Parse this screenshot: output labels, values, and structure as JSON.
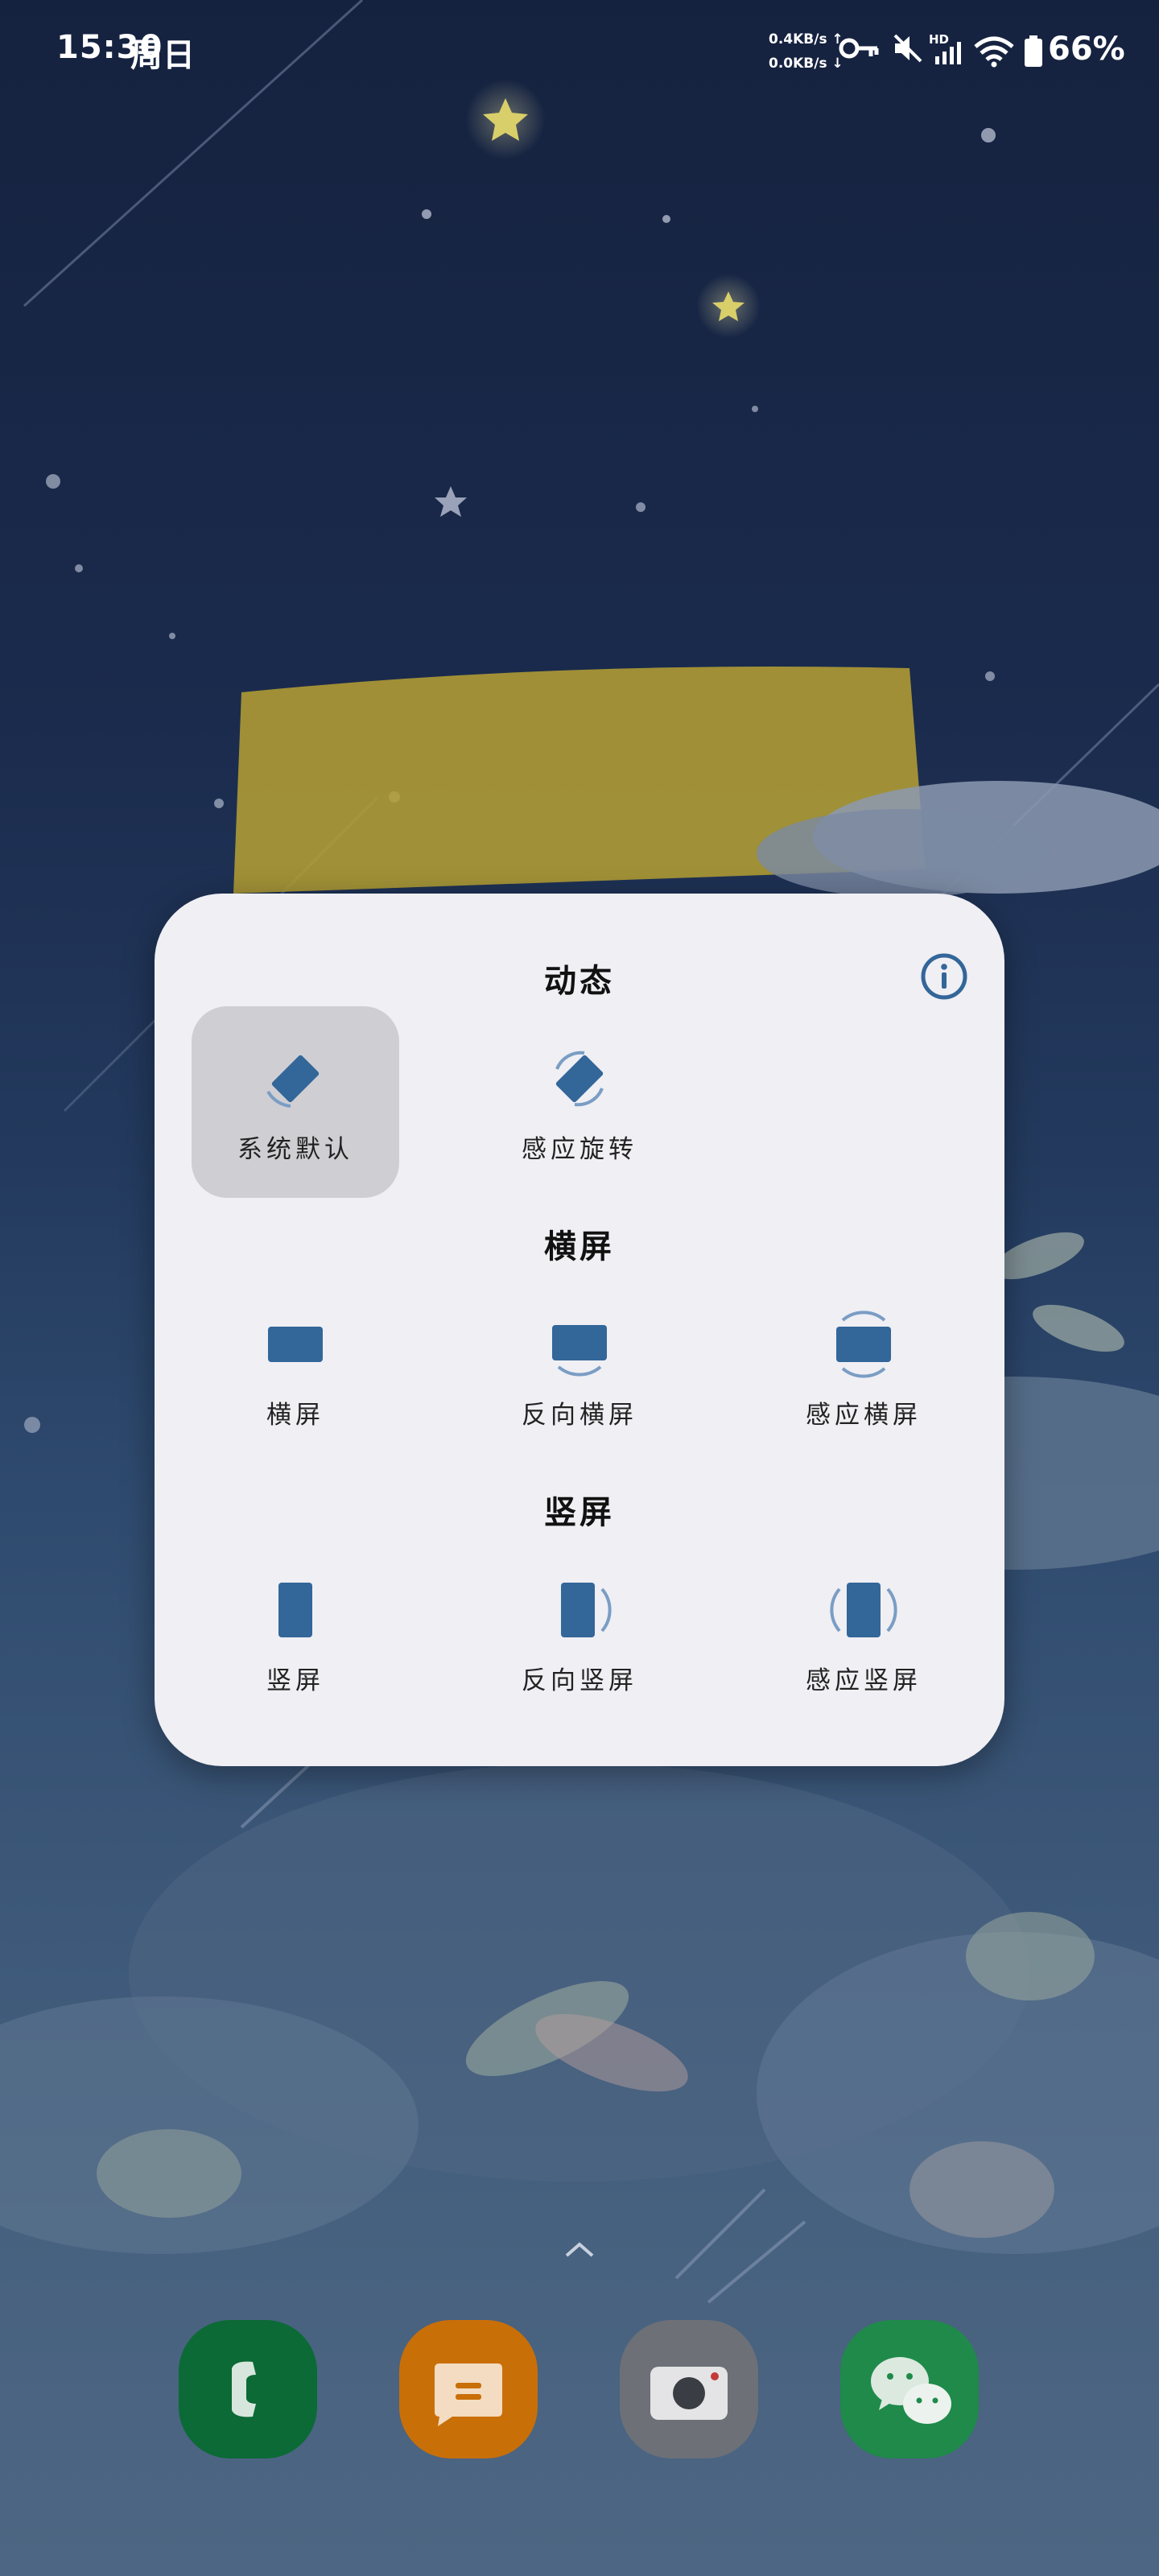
{
  "status_bar": {
    "time": "15:30",
    "day": "周日",
    "upload_speed": "0.4KB/s ↑",
    "download_speed": "0.0KB/s ↓",
    "network_type": "HD",
    "battery": "66%",
    "icons": [
      "key-icon",
      "mute-icon",
      "signal-icon",
      "wifi-icon",
      "battery-icon"
    ]
  },
  "rotation_panel": {
    "info_icon": "info-icon",
    "accent_color": "#336699",
    "sections": [
      {
        "title": "动态",
        "options": [
          {
            "label": "系统默认",
            "icon": "system-default-rotation-icon",
            "selected": true
          },
          {
            "label": "感应旋转",
            "icon": "sensor-rotation-icon",
            "selected": false
          }
        ]
      },
      {
        "title": "横屏",
        "options": [
          {
            "label": "横屏",
            "icon": "landscape-icon",
            "selected": false
          },
          {
            "label": "反向横屏",
            "icon": "reverse-landscape-icon",
            "selected": false
          },
          {
            "label": "感应横屏",
            "icon": "sensor-landscape-icon",
            "selected": false
          }
        ]
      },
      {
        "title": "竖屏",
        "options": [
          {
            "label": "竖屏",
            "icon": "portrait-icon",
            "selected": false
          },
          {
            "label": "反向竖屏",
            "icon": "reverse-portrait-icon",
            "selected": false
          },
          {
            "label": "感应竖屏",
            "icon": "sensor-portrait-icon",
            "selected": false
          }
        ]
      }
    ]
  },
  "home": {
    "swipe_up_icon": "chevron-up-icon",
    "dock": [
      {
        "icon": "phone-app-icon",
        "color": "#0b6a35"
      },
      {
        "icon": "messages-app-icon",
        "color": "#c96f08"
      },
      {
        "icon": "camera-app-icon",
        "color": "#6d7077"
      },
      {
        "icon": "wechat-app-icon",
        "color": "#1f8a4a"
      }
    ]
  }
}
